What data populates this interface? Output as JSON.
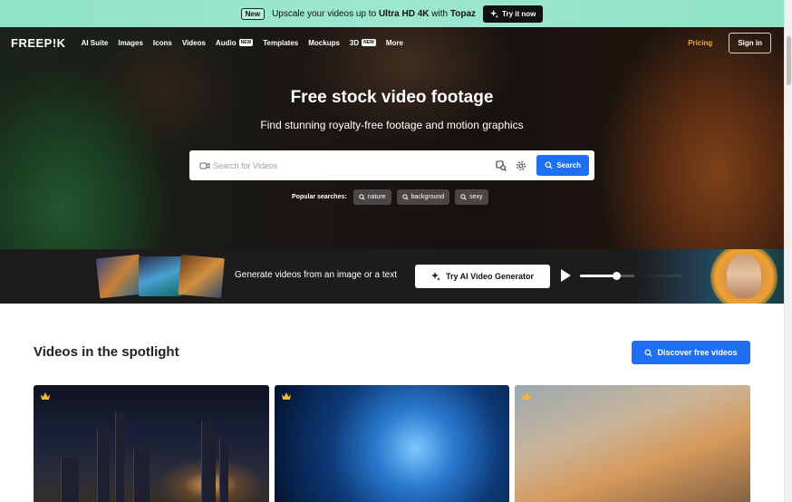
{
  "promo": {
    "badge": "New",
    "text_prefix": "Upscale your videos up to",
    "text_strong1": "Ultra HD 4K",
    "text_mid": "with",
    "text_strong2": "Topaz",
    "button_label": "Try it now"
  },
  "nav": {
    "logo": "FREEP!K",
    "links": [
      {
        "label": "AI Suite"
      },
      {
        "label": "Images"
      },
      {
        "label": "Icons"
      },
      {
        "label": "Videos"
      },
      {
        "label": "Audio",
        "badge": "NEW"
      },
      {
        "label": "Templates"
      },
      {
        "label": "Mockups"
      },
      {
        "label": "3D",
        "badge": "NEW"
      },
      {
        "label": "More"
      }
    ],
    "pricing": "Pricing",
    "signin": "Sign in"
  },
  "hero": {
    "title": "Free stock video footage",
    "subtitle": "Find stunning royalty-free footage and motion graphics"
  },
  "search": {
    "placeholder": "Search for Videos",
    "button_label": "Search"
  },
  "popular": {
    "label": "Popular searches:",
    "chips": [
      "nature",
      "background",
      "sexy"
    ]
  },
  "generator": {
    "text": "Generate videos from an image or a text",
    "button_label": "Try AI Video Generator",
    "progress": 0.36
  },
  "spotlight": {
    "title": "Videos in the spotlight",
    "discover_label": "Discover free videos"
  },
  "colors": {
    "accent_blue": "#1f6ff2",
    "pricing_orange": "#f6a73b",
    "promo_mint": "#9ee7d0"
  }
}
